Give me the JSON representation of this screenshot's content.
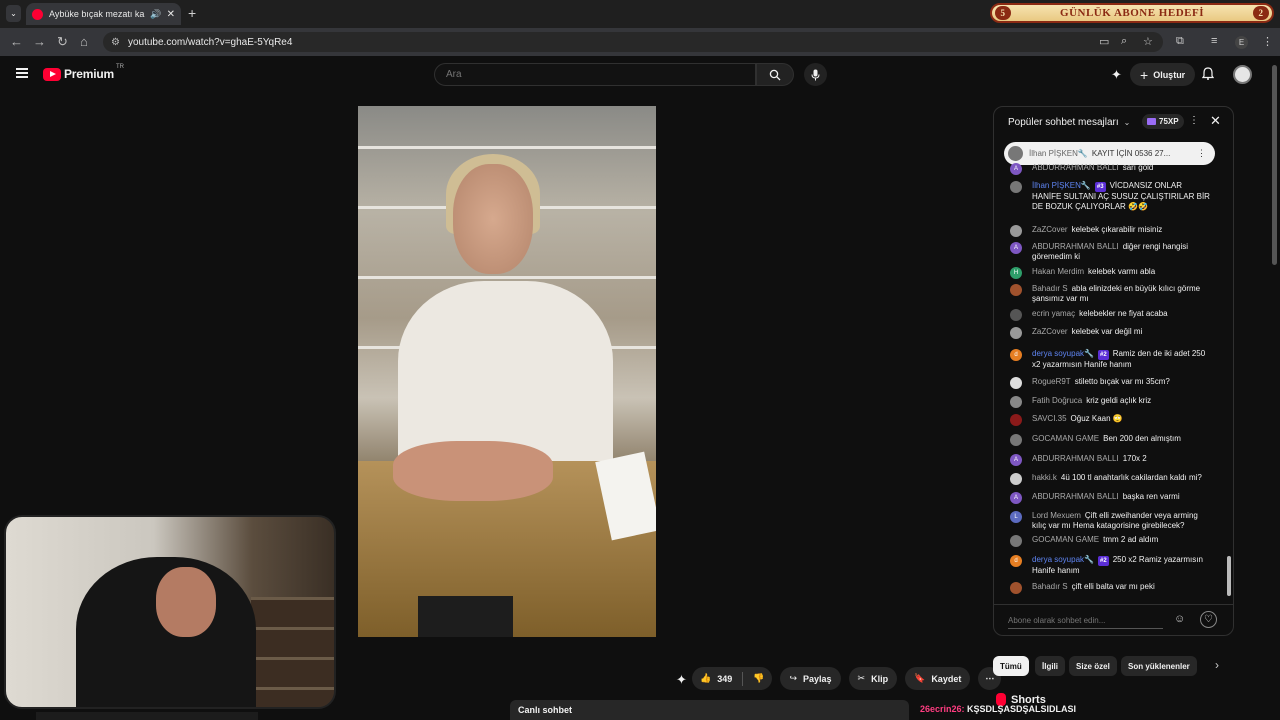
{
  "browser": {
    "tab_title": "Aybüke bıçak mezatı kanalı",
    "url": "youtube.com/watch?v=ghaE-5YqRe4",
    "profile_initial": "E"
  },
  "overlay": {
    "banner_text": "GÜNLÜK ABONE HEDEFİ",
    "banner_left": "5",
    "banner_right": "2"
  },
  "header": {
    "logo_text": "Premium",
    "country": "TR",
    "search_placeholder": "Ara",
    "create_label": "Oluştur"
  },
  "chat": {
    "title": "Popüler sohbet mesajları",
    "xp": "75XP",
    "pinned": {
      "name": "İlhan PİŞKEN🔧",
      "text": "KAYIT İÇİN 0536 27..."
    },
    "input_placeholder": "Abone olarak sohbet edin...",
    "messages": [
      {
        "name": "ABDURRAHMAN BALLI",
        "text": "sarı gold",
        "initial": "A",
        "color": "#7e57c2"
      },
      {
        "name": "İlhan PİŞKEN🔧",
        "badge": "#3",
        "text": "VİCDANSIZ ONLAR HANİFE SULTANI AÇ SUSUZ ÇALIŞTIRILAR BİR DE BOZUK ÇALIYORLAR 🤣🤣",
        "initial": "",
        "color": "#777"
      },
      {
        "name": "ZaZCover",
        "text": "kelebek çıkarabilir misiniz",
        "initial": "",
        "color": "#999"
      },
      {
        "name": "ABDURRAHMAN BALLI",
        "text": "diğer rengi hangisi göremedim ki",
        "initial": "A",
        "color": "#7e57c2"
      },
      {
        "name": "Hakan Merdim",
        "text": "kelebek varmı abla",
        "initial": "H",
        "color": "#2e9e6a"
      },
      {
        "name": "Bahadır S",
        "text": "abla elinizdeki en büyük kılıcı görme şansımız var mı",
        "initial": "",
        "color": "#a0522d"
      },
      {
        "name": "ecrin yamaç",
        "text": "kelebekler ne fiyat acaba",
        "initial": "",
        "color": "#555"
      },
      {
        "name": "ZaZCover",
        "text": "kelebek var değil mi",
        "initial": "",
        "color": "#999"
      },
      {
        "name": "derya soyupak🔧",
        "badge": "#2",
        "text": "Ramiz den de iki adet 250 x2 yazarmısın Hanife hanım",
        "initial": "d",
        "color": "#e67e22"
      },
      {
        "name": "RogueR9T",
        "text": "stiletto bıçak var mı 35cm?",
        "initial": "",
        "color": "#ddd"
      },
      {
        "name": "Fatih Doğruca",
        "text": "kriz geldi açlık kriz",
        "initial": "",
        "color": "#888"
      },
      {
        "name": "SAVCI.35",
        "text": "Oğuz Kaan 🙄",
        "initial": "",
        "color": "#8b1a1a"
      },
      {
        "name": "GOCAMAN GAME",
        "text": "Ben 200 den almıştım",
        "initial": "",
        "color": "#777"
      },
      {
        "name": "ABDURRAHMAN BALLI",
        "text": "170x 2",
        "initial": "A",
        "color": "#7e57c2"
      },
      {
        "name": "hakki.k",
        "text": "4ü 100 tl anahtarlık cakilardan kaldı mi?",
        "initial": "",
        "color": "#ccc"
      },
      {
        "name": "ABDURRAHMAN BALLI",
        "text": "başka ren varmi",
        "initial": "A",
        "color": "#7e57c2"
      },
      {
        "name": "Lord Mexuem",
        "text": "Çift elli zweihander veya arming kılıç var mı Hema katagorisine girebilecek?",
        "initial": "L",
        "color": "#5c6bc0"
      },
      {
        "name": "GOCAMAN GAME",
        "text": "tmm 2 ad aldım",
        "initial": "",
        "color": "#777"
      },
      {
        "name": "derya soyupak🔧",
        "badge": "#2",
        "text": "250 x2 Ramiz yazarmısın Hanife hanım",
        "initial": "d",
        "color": "#e67e22"
      },
      {
        "name": "Bahadır S",
        "text": "çift elli balta var mı peki",
        "initial": "",
        "color": "#a0522d"
      }
    ]
  },
  "actions": {
    "likes": "349",
    "share": "Paylaş",
    "clip": "Klip",
    "save": "Kaydet"
  },
  "chips": [
    "Tümü",
    "İlgili",
    "Size özel",
    "Son yüklenenler"
  ],
  "bottom": {
    "live_chat": "Canlı sohbet",
    "shorts": "Shorts",
    "ticker_name": "26ecrin26:",
    "ticker_text": "KŞSDLŞASDŞALSIDLASI"
  }
}
